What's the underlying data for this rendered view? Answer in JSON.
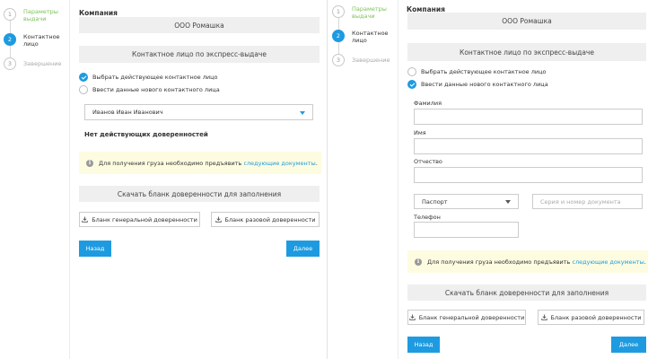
{
  "steps": [
    {
      "num": "1",
      "label": "Параметры выдачи",
      "state": "done"
    },
    {
      "num": "2",
      "label": "Контактное лицо",
      "state": "active"
    },
    {
      "num": "3",
      "label": "Завершение",
      "state": "pending"
    }
  ],
  "company_label": "Компания",
  "company_name": "ООО Ромашка",
  "contact_section": "Контактное лицо по экспресс-выдаче",
  "radio_existing": "Выбрать действующее контактное лицо",
  "radio_new": "Ввести данные нового контактного лица",
  "left": {
    "selected_contact": "Иванов Иван Иванович",
    "no_poa": "Нет действующих доверенностей"
  },
  "info_prefix": "Для получения груза необходимо предъявить ",
  "info_link": "следующие документы",
  "info_suffix": ".",
  "download_blank": "Скачать бланк доверенности для заполнения",
  "btn_general": "Бланк генеральной доверенности",
  "btn_single": "Бланк разовой доверенности",
  "btn_back": "Назад",
  "btn_next": "Далее",
  "right": {
    "label_lastname": "Фамилия",
    "label_firstname": "Имя",
    "label_patronymic": "Отчество",
    "doc_type": "Паспорт",
    "doc_placeholder": "Серия и номер документа",
    "label_phone": "Телефон"
  },
  "colors": {
    "accent": "#1e9be0",
    "done": "#7cc35a",
    "info_bg": "#fdfce1"
  }
}
